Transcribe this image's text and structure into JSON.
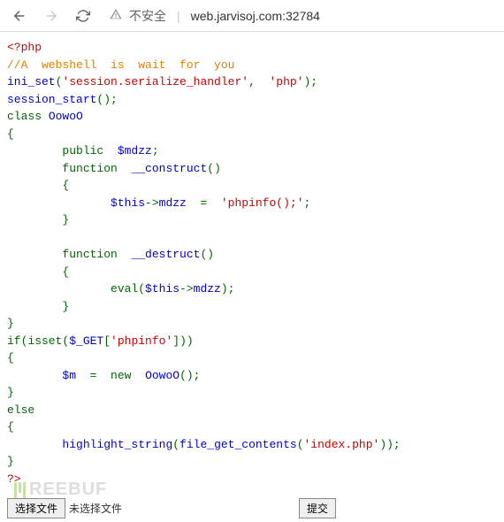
{
  "browser": {
    "security_label": "不安全",
    "url": "web.jarvisoj.com:32784"
  },
  "code": {
    "line01a": "<?php",
    "line02": "//A  webshell  is  wait  for  you",
    "line03_fn": "ini_set",
    "line03_p": "(",
    "line03_s1": "'session.serialize_handler'",
    "line03_c": ",  ",
    "line03_s2": "'php'",
    "line03_end": ");",
    "line04_fn": "session_start",
    "line04_end": "();",
    "line05a": "class ",
    "line05b": "OowoO",
    "line06": "{",
    "line07a": "        public  ",
    "line07b": "$mdzz",
    "line07c": ";",
    "line08a": "        function  ",
    "line08b": "__construct",
    "line08c": "()",
    "line09": "        {",
    "line10a": "               ",
    "line10b": "$this",
    "line10c": "->",
    "line10d": "mdzz  ",
    "line10e": "=  ",
    "line10f": "'phpinfo();'",
    "line10g": ";",
    "line11": "        }",
    "line13a": "        function  ",
    "line13b": "__destruct",
    "line13c": "()",
    "line14": "        {",
    "line15a": "               eval(",
    "line15b": "$this",
    "line15c": "->",
    "line15d": "mdzz",
    "line15e": ");",
    "line16": "        }",
    "line17": "}",
    "line18a": "if(isset(",
    "line18b": "$_GET",
    "line18c": "[",
    "line18d": "'phpinfo'",
    "line18e": "]))",
    "line19": "{",
    "line20a": "        ",
    "line20b": "$m  ",
    "line20c": "=  new  ",
    "line20d": "OowoO",
    "line20e": "();",
    "line21": "}",
    "line22": "else",
    "line23": "{",
    "line24a": "        ",
    "line24b": "highlight_string",
    "line24c": "(",
    "line24d": "file_get_contents",
    "line24e": "(",
    "line24f": "'index.php'",
    "line24g": "));",
    "line25": "}",
    "line26": "?>"
  },
  "form": {
    "choose_file": "选择文件",
    "no_file": "未选择文件",
    "submit": "提交"
  },
  "watermark": "REEBUF"
}
